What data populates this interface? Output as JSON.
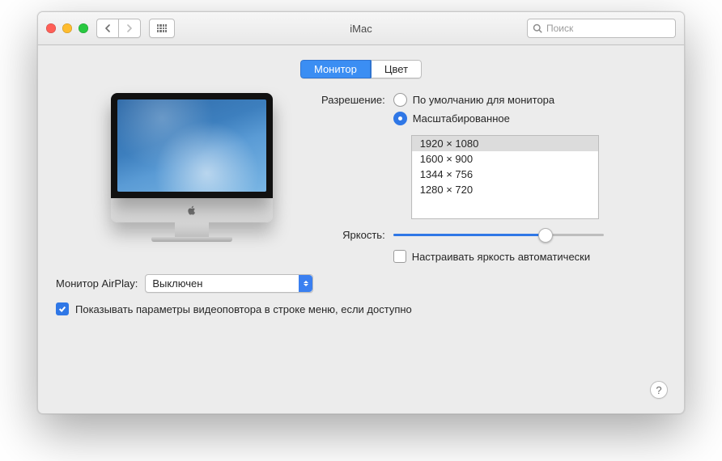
{
  "window": {
    "title": "iMac"
  },
  "search": {
    "placeholder": "Поиск"
  },
  "tabs": {
    "monitor": "Монитор",
    "color": "Цвет",
    "active": "monitor"
  },
  "labels": {
    "resolution": "Разрешение:",
    "brightness": "Яркость:",
    "airplay": "Монитор AirPlay:"
  },
  "resolution": {
    "options": {
      "default": "По умолчанию для монитора",
      "scaled": "Масштабированное"
    },
    "selected": "scaled",
    "list": [
      "1920 × 1080",
      "1600 × 900",
      "1344 × 756",
      "1280 × 720"
    ],
    "list_selected_index": 0
  },
  "brightness": {
    "value": 0.72,
    "auto_label": "Настраивать яркость автоматически",
    "auto_checked": false
  },
  "airplay": {
    "value": "Выключен"
  },
  "mirroring": {
    "label": "Показывать параметры видеоповтора в строке меню, если доступно",
    "checked": true
  },
  "help": "?"
}
